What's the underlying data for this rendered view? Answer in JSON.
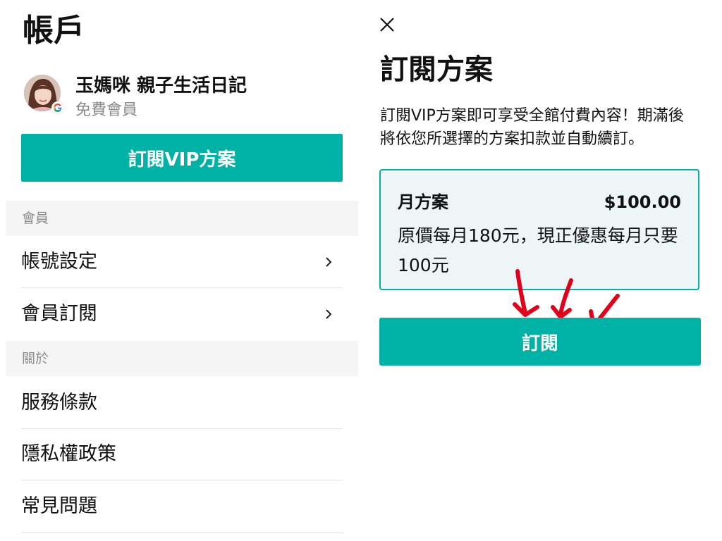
{
  "account": {
    "title": "帳戶",
    "profile": {
      "name": "玉媽咪 親子生活日記",
      "status": "免費會員",
      "login_provider_icon": "google-icon"
    },
    "vip_button_label": "訂閱VIP方案",
    "sections": [
      {
        "header": "會員",
        "items": [
          {
            "label": "帳號設定",
            "icon": "chevron-right-icon"
          },
          {
            "label": "會員訂閱",
            "icon": "chevron-right-icon"
          }
        ]
      },
      {
        "header": "關於",
        "items": [
          {
            "label": "服務條款"
          },
          {
            "label": "隱私權政策"
          },
          {
            "label": "常見問題"
          }
        ]
      }
    ]
  },
  "subscription": {
    "close_icon": "close-icon",
    "title": "訂閱方案",
    "description": "訂閱VIP方案即可享受全館付費內容！期滿後將依您所選擇的方案扣款並自動續訂。",
    "plan": {
      "name": "月方案",
      "price": "$100.00",
      "note": "原價每月180元，現正優惠每月只要100元"
    },
    "annotation_icon": "red-hand-drawn-arrows",
    "subscribe_button_label": "訂閱"
  },
  "colors": {
    "accent": "#00b1a5",
    "card_background": "#eef5f6",
    "section_background": "#f5f5f5",
    "annotation": "#e0001a"
  }
}
